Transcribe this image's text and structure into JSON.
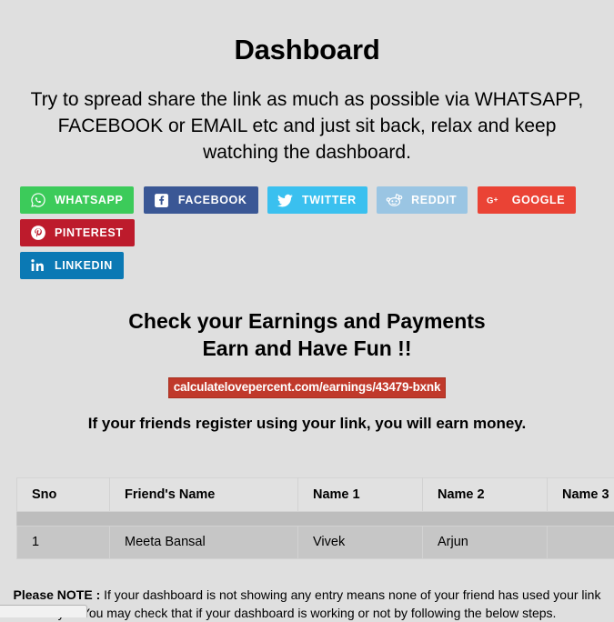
{
  "header": {
    "title": "Dashboard",
    "intro": "Try to spread share the link as much as possible via WHATSAPP, FACEBOOK or EMAIL etc and just sit back, relax and keep watching the dashboard."
  },
  "share": {
    "buttons": [
      {
        "label": "WHATSAPP",
        "icon": "whatsapp-icon",
        "color": "#3ccb5a"
      },
      {
        "label": "FACEBOOK",
        "icon": "facebook-icon",
        "color": "#3a5795"
      },
      {
        "label": "TWITTER",
        "icon": "twitter-icon",
        "color": "#3ac0ef"
      },
      {
        "label": "REDDIT",
        "icon": "reddit-icon",
        "color": "#9ac5e3"
      },
      {
        "label": "GOOGLE",
        "icon": "google-plus-icon",
        "color": "#ea4335"
      },
      {
        "label": "PINTEREST",
        "icon": "pinterest-icon",
        "color": "#bd1b2c"
      },
      {
        "label": "LINKEDIN",
        "icon": "linkedin-icon",
        "color": "#0b79b4"
      }
    ]
  },
  "earnings": {
    "heading_line1": "Check your Earnings and Payments",
    "heading_line2": "Earn and Have Fun !!",
    "referral_link": "calculatelovepercent.com/earnings/43479-bxnk",
    "referral_link_bg": "#c0392b",
    "earn_money_note": "If your friends register using your link, you will earn money."
  },
  "table": {
    "columns": [
      "Sno",
      "Friend's Name",
      "Name 1",
      "Name 2",
      "Name 3"
    ],
    "rows": [
      {
        "sno": "1",
        "friend_name": "Meeta Bansal",
        "name1": "Vivek",
        "name2": "Arjun",
        "name3": ""
      }
    ]
  },
  "note": {
    "label": "Please NOTE :",
    "text": " If your dashboard is not showing any entry means none of your friend has used your link yet. You may check that if your dashboard is working or not by following the below steps."
  }
}
